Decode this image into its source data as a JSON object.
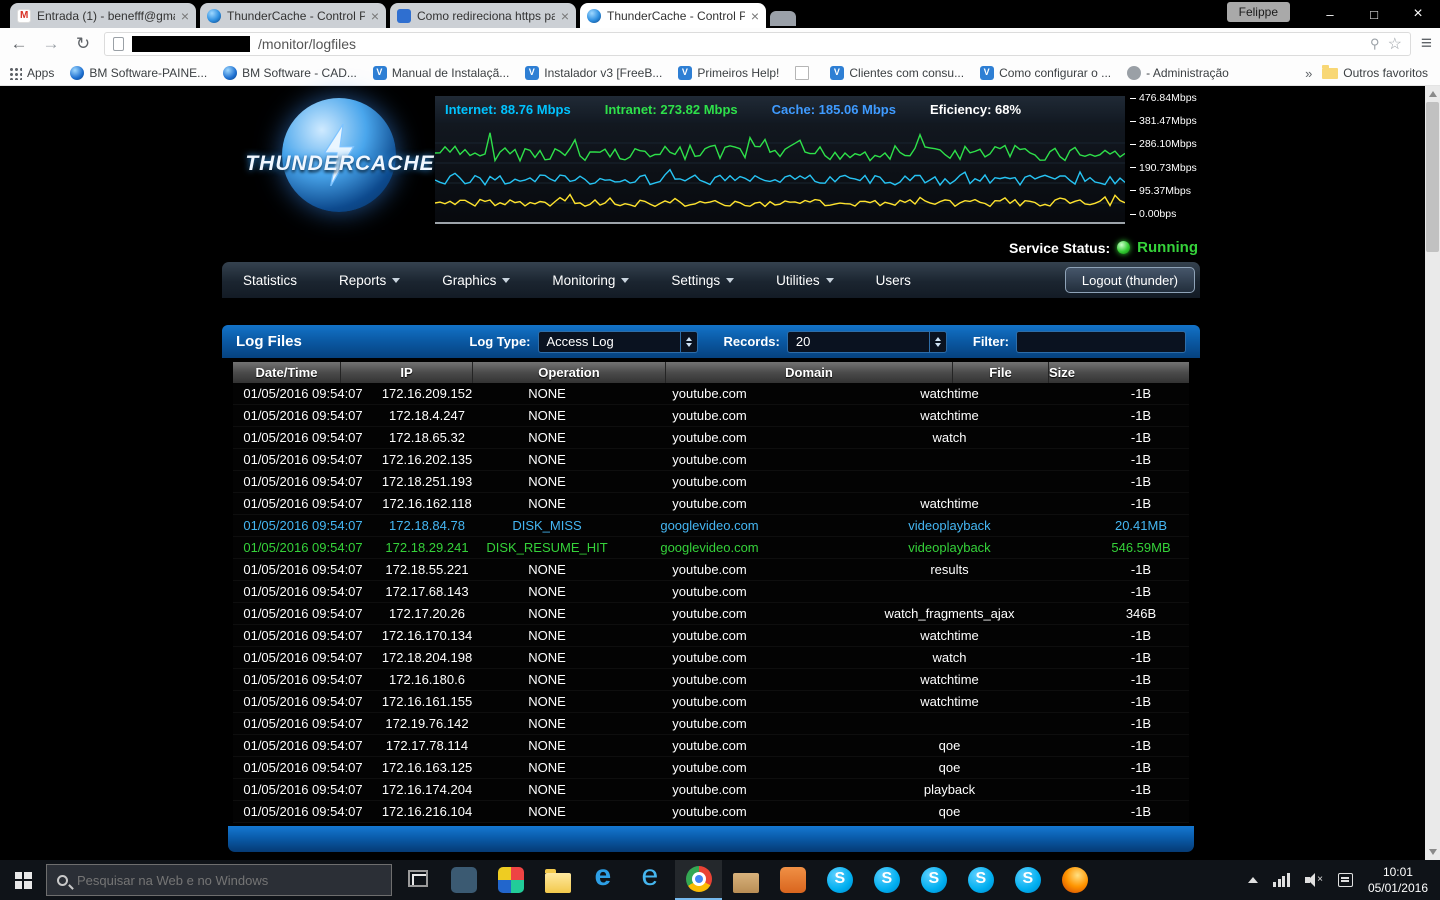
{
  "colors": {
    "accent_blue": "#0a62b0",
    "status_green": "#35d23a",
    "row_miss_cyan": "#45b6f2",
    "row_hit_green": "#35d23a",
    "stat_internet": "#00c3ff",
    "stat_intranet": "#2ee04a",
    "stat_cache": "#3f9bff"
  },
  "browser": {
    "user_badge": "Felippe",
    "url_suffix": "/monitor/logfiles",
    "tabs": [
      {
        "label": "Entrada (1) - benefff@gma..."
      },
      {
        "label": "ThunderCache - Control P..."
      },
      {
        "label": "Como redireciona https pa..."
      },
      {
        "label": "ThunderCache - Control P..."
      }
    ],
    "bookmarks": [
      {
        "label": "Apps",
        "variant": "apps"
      },
      {
        "label": "BM Software-PAINE...",
        "variant": "circle"
      },
      {
        "label": "BM Software - CAD...",
        "variant": "circle"
      },
      {
        "label": "Manual de Instalaçã...",
        "variant": "v"
      },
      {
        "label": "Instalador v3 [FreeB...",
        "variant": "v"
      },
      {
        "label": "Primeiros Help!",
        "variant": "v"
      },
      {
        "label": "",
        "variant": "page"
      },
      {
        "label": "Clientes com consu...",
        "variant": "v"
      },
      {
        "label": "Como configurar o ...",
        "variant": "v"
      },
      {
        "label": "- Administração",
        "variant": "gray"
      }
    ],
    "overflow_chevron": "»",
    "other_favorites": "Outros favoritos"
  },
  "monitor": {
    "logo_text": "THUNDERCACHE",
    "stats": [
      {
        "name": "stat-internet",
        "label": "Internet:",
        "value": "88.76 Mbps",
        "variant": "internet"
      },
      {
        "name": "stat-intranet",
        "label": "Intranet:",
        "value": "273.82 Mbps",
        "variant": "intranet"
      },
      {
        "name": "stat-cache",
        "label": "Cache:",
        "value": "185.06 Mbps",
        "variant": "cache"
      },
      {
        "name": "stat-efficiency",
        "label": "Eficiency:",
        "value": "68%",
        "variant": "efficiency"
      }
    ],
    "axis_labels": [
      "476.84Mbps",
      "381.47Mbps",
      "286.10Mbps",
      "190.73Mbps",
      "95.37Mbps",
      "0.00bps"
    ],
    "service_status_label": "Service Status:",
    "service_status_value": "Running"
  },
  "nav": {
    "items": [
      {
        "name": "nav-item-statistics",
        "label": "Statistics"
      },
      {
        "name": "nav-item-reports",
        "label": "Reports",
        "variant": "dropdown"
      },
      {
        "name": "nav-item-graphics",
        "label": "Graphics",
        "variant": "dropdown"
      },
      {
        "name": "nav-item-monitoring",
        "label": "Monitoring",
        "variant": "dropdown"
      },
      {
        "name": "nav-item-settings",
        "label": "Settings",
        "variant": "dropdown"
      },
      {
        "name": "nav-item-utilities",
        "label": "Utilities",
        "variant": "dropdown"
      },
      {
        "name": "nav-item-users",
        "label": "Users"
      }
    ],
    "logout_label": "Logout (thunder)"
  },
  "logfiles": {
    "title": "Log Files",
    "log_type_label": "Log Type:",
    "log_type_value": "Access Log",
    "records_label": "Records:",
    "records_value": "20",
    "filter_label": "Filter:",
    "columns": [
      "Date/Time",
      "IP",
      "Operation",
      "Domain",
      "File",
      "Size"
    ],
    "rows": [
      {
        "datetime": "01/05/2016 09:54:07",
        "ip": "172.16.209.152",
        "operation": "NONE",
        "domain": "youtube.com",
        "file": "watchtime",
        "size": "-1B"
      },
      {
        "datetime": "01/05/2016 09:54:07",
        "ip": "172.18.4.247",
        "operation": "NONE",
        "domain": "youtube.com",
        "file": "watchtime",
        "size": "-1B"
      },
      {
        "datetime": "01/05/2016 09:54:07",
        "ip": "172.18.65.32",
        "operation": "NONE",
        "domain": "youtube.com",
        "file": "watch",
        "size": "-1B"
      },
      {
        "datetime": "01/05/2016 09:54:07",
        "ip": "172.16.202.135",
        "operation": "NONE",
        "domain": "youtube.com",
        "file": "",
        "size": "-1B"
      },
      {
        "datetime": "01/05/2016 09:54:07",
        "ip": "172.18.251.193",
        "operation": "NONE",
        "domain": "youtube.com",
        "file": "",
        "size": "-1B"
      },
      {
        "datetime": "01/05/2016 09:54:07",
        "ip": "172.16.162.118",
        "operation": "NONE",
        "domain": "youtube.com",
        "file": "watchtime",
        "size": "-1B"
      },
      {
        "datetime": "01/05/2016 09:54:07",
        "ip": "172.18.84.78",
        "operation": "DISK_MISS",
        "domain": "googlevideo.com",
        "file": "videoplayback",
        "size": "20.41MB",
        "variant": "miss"
      },
      {
        "datetime": "01/05/2016 09:54:07",
        "ip": "172.18.29.241",
        "operation": "DISK_RESUME_HIT",
        "domain": "googlevideo.com",
        "file": "videoplayback",
        "size": "546.59MB",
        "variant": "hit"
      },
      {
        "datetime": "01/05/2016 09:54:07",
        "ip": "172.18.55.221",
        "operation": "NONE",
        "domain": "youtube.com",
        "file": "results",
        "size": "-1B"
      },
      {
        "datetime": "01/05/2016 09:54:07",
        "ip": "172.17.68.143",
        "operation": "NONE",
        "domain": "youtube.com",
        "file": "",
        "size": "-1B"
      },
      {
        "datetime": "01/05/2016 09:54:07",
        "ip": "172.17.20.26",
        "operation": "NONE",
        "domain": "youtube.com",
        "file": "watch_fragments_ajax",
        "size": "346B"
      },
      {
        "datetime": "01/05/2016 09:54:07",
        "ip": "172.16.170.134",
        "operation": "NONE",
        "domain": "youtube.com",
        "file": "watchtime",
        "size": "-1B"
      },
      {
        "datetime": "01/05/2016 09:54:07",
        "ip": "172.18.204.198",
        "operation": "NONE",
        "domain": "youtube.com",
        "file": "watch",
        "size": "-1B"
      },
      {
        "datetime": "01/05/2016 09:54:07",
        "ip": "172.16.180.6",
        "operation": "NONE",
        "domain": "youtube.com",
        "file": "watchtime",
        "size": "-1B"
      },
      {
        "datetime": "01/05/2016 09:54:07",
        "ip": "172.16.161.155",
        "operation": "NONE",
        "domain": "youtube.com",
        "file": "watchtime",
        "size": "-1B"
      },
      {
        "datetime": "01/05/2016 09:54:07",
        "ip": "172.19.76.142",
        "operation": "NONE",
        "domain": "youtube.com",
        "file": "",
        "size": "-1B"
      },
      {
        "datetime": "01/05/2016 09:54:07",
        "ip": "172.17.78.114",
        "operation": "NONE",
        "domain": "youtube.com",
        "file": "qoe",
        "size": "-1B"
      },
      {
        "datetime": "01/05/2016 09:54:07",
        "ip": "172.16.163.125",
        "operation": "NONE",
        "domain": "youtube.com",
        "file": "qoe",
        "size": "-1B"
      },
      {
        "datetime": "01/05/2016 09:54:07",
        "ip": "172.16.174.204",
        "operation": "NONE",
        "domain": "youtube.com",
        "file": "playback",
        "size": "-1B"
      },
      {
        "datetime": "01/05/2016 09:54:07",
        "ip": "172.16.216.104",
        "operation": "NONE",
        "domain": "youtube.com",
        "file": "qoe",
        "size": "-1B"
      }
    ]
  },
  "taskbar": {
    "search_placeholder": "Pesquisar na Web e no Windows",
    "clock_time": "10:01",
    "clock_date": "05/01/2016",
    "app_icons": [
      {
        "name": "messaging-icon",
        "variant": "messaging"
      },
      {
        "name": "photos-icon",
        "variant": "photos"
      },
      {
        "name": "file-explorer-icon",
        "variant": "explorer"
      },
      {
        "name": "edge-icon",
        "variant": "edge"
      },
      {
        "name": "internet-explorer-icon",
        "variant": "ie"
      },
      {
        "name": "chrome-icon",
        "variant": "chrome"
      },
      {
        "name": "folder-icon",
        "variant": "folder"
      },
      {
        "name": "pictures-icon",
        "variant": "pictures"
      },
      {
        "name": "skype-icon",
        "variant": "skype"
      },
      {
        "name": "skype-icon",
        "variant": "skype"
      },
      {
        "name": "skype-icon",
        "variant": "skype"
      },
      {
        "name": "skype-icon",
        "variant": "skype"
      },
      {
        "name": "skype-icon",
        "variant": "skype"
      },
      {
        "name": "firefox-icon",
        "variant": "firefox"
      }
    ]
  }
}
